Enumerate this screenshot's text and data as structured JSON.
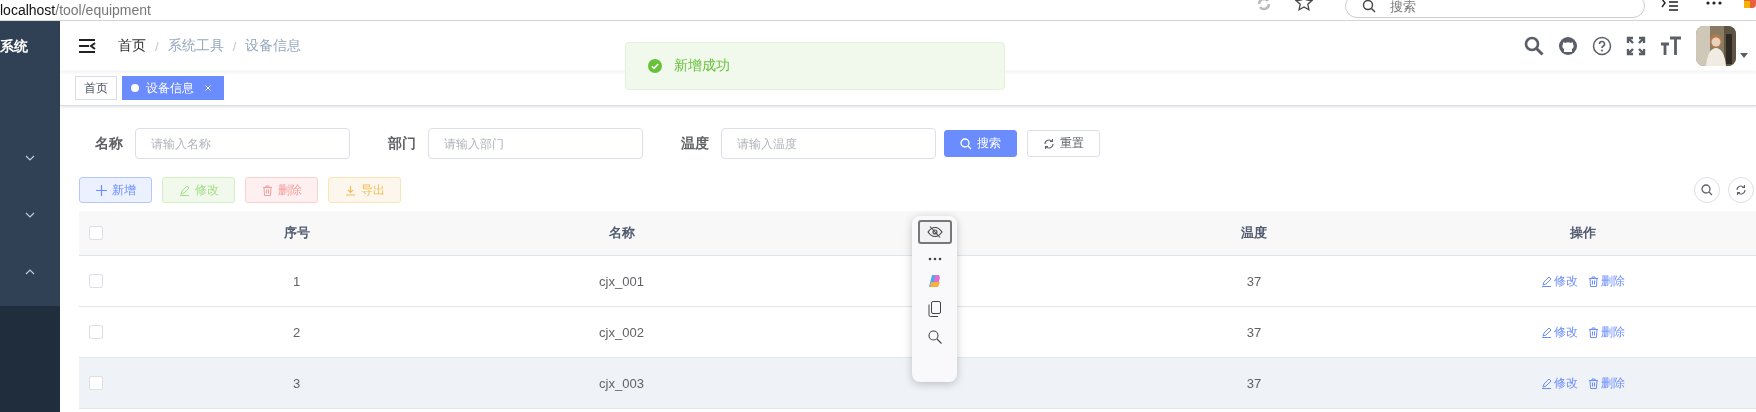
{
  "browser": {
    "url_host": "localhost",
    "url_path": "/tool/equipment",
    "search_placeholder": "搜索"
  },
  "sidebar": {
    "title": "系统",
    "groups": [
      {
        "expanded": false
      },
      {
        "expanded": false
      },
      {
        "expanded": true
      }
    ]
  },
  "breadcrumb": [
    {
      "label": "首页",
      "link": true
    },
    {
      "separator": "/",
      "label": "系统工具",
      "link": false
    },
    {
      "separator": "/",
      "label": "设备信息",
      "link": false
    }
  ],
  "tags": [
    {
      "label": "首页",
      "selected": false,
      "closable": false
    },
    {
      "label": "设备信息",
      "selected": true,
      "closable": true
    }
  ],
  "toast": {
    "message": "新增成功"
  },
  "search_form": {
    "fields": [
      {
        "label": "名称",
        "placeholder": "请输入名称"
      },
      {
        "label": "部门",
        "placeholder": "请输入部门"
      },
      {
        "label": "温度",
        "placeholder": "请输入温度"
      }
    ],
    "buttons": [
      {
        "kind": "primary",
        "label": "搜索"
      },
      {
        "kind": "default",
        "label": "重置"
      }
    ]
  },
  "toolbar": {
    "buttons": [
      {
        "kind": "primary",
        "label": "新增"
      },
      {
        "kind": "success",
        "label": "修改"
      },
      {
        "kind": "danger",
        "label": "删除"
      },
      {
        "kind": "warning",
        "label": "导出"
      }
    ]
  },
  "table": {
    "columns": [
      "序号",
      "名称",
      "温度",
      "操作"
    ],
    "header_checked": false,
    "rows": [
      {
        "checked": false,
        "highlighted": false,
        "index": "1",
        "name": "cjx_001",
        "temperature": "37",
        "actions": [
          "修改",
          "删除"
        ]
      },
      {
        "checked": false,
        "highlighted": false,
        "index": "2",
        "name": "cjx_002",
        "temperature": "37",
        "actions": [
          "修改",
          "删除"
        ]
      },
      {
        "checked": false,
        "highlighted": true,
        "index": "3",
        "name": "cjx_003",
        "temperature": "37",
        "actions": [
          "修改",
          "删除"
        ]
      }
    ]
  }
}
